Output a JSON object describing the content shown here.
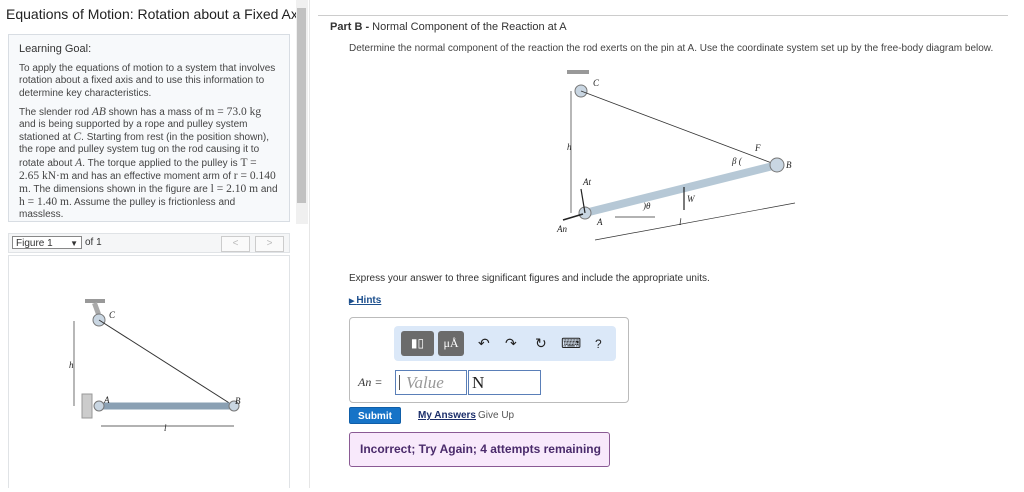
{
  "title": "Equations of Motion: Rotation about a Fixed Axis",
  "goal": {
    "heading": "Learning Goal:",
    "p1": "To apply the equations of motion to a system that involves rotation about a fixed axis and to use this information to determine key characteristics.",
    "p2": {
      "a": "The slender rod ",
      "AB": "AB",
      "b": " shown has a mass of ",
      "m": "m = 73.0 kg",
      "c": " and is being supported by a rope and pulley system stationed at ",
      "C": "C",
      "d": ". Starting from rest (in the position shown), the rope and pulley system tug on the rod causing it to rotate about ",
      "A": "A",
      "e": ". The torque applied to the pulley is ",
      "T": "T = 2.65 kN·m",
      "f": " and has an effective moment arm of ",
      "r": "r = 0.140 m",
      "g": ". The dimensions shown in the figure are ",
      "l": "l = 2.10 m",
      "h_and": " and ",
      "h": "h = 1.40 m",
      "i": ". Assume the pulley is frictionless and massless."
    }
  },
  "figure": {
    "selected": "Figure 1",
    "of": "of 1",
    "prev": "<",
    "next": ">",
    "labels": {
      "C": "C",
      "h": "h",
      "A": "A",
      "B": "B",
      "l": "l"
    }
  },
  "part": {
    "label": "Part B -",
    "title": " Normal Component of the Reaction at A",
    "description": "Determine the normal component of the reaction the rod exerts on the pin at A. Use the coordinate system set up by the free-body diagram below.",
    "fbd": {
      "C": "C",
      "h": "h",
      "At": "At",
      "An": "An",
      "A": "A",
      "theta": ")θ",
      "W": "W",
      "l": "l",
      "beta": "β (",
      "F": "F",
      "B": "B"
    },
    "express": "Express your answer to three significant figures and include the appropriate units.",
    "hints": "Hints"
  },
  "answer": {
    "label": "An =",
    "placeholder": "Value",
    "unit": "N",
    "toolbar": {
      "templates": "▮▯",
      "units": "μÅ",
      "undo": "↶",
      "redo": "↷",
      "reset": "↻",
      "keyboard": "⌨",
      "help": "?"
    }
  },
  "actions": {
    "submit": "Submit",
    "my_answers": "My Answers",
    "give_up": "Give Up"
  },
  "feedback": "Incorrect; Try Again; 4 attempts remaining"
}
